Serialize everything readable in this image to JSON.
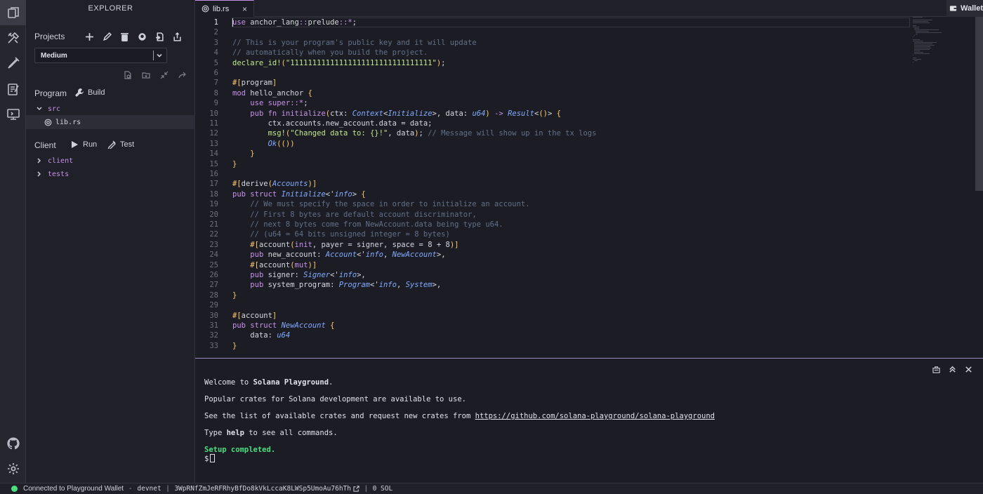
{
  "activity": {
    "items": [
      {
        "name": "explorer-icon",
        "active": true
      },
      {
        "name": "build-deploy-icon"
      },
      {
        "name": "test-icon"
      },
      {
        "name": "tutorials-icon"
      },
      {
        "name": "programs-icon"
      }
    ],
    "bottom": [
      "github-icon",
      "settings-icon"
    ]
  },
  "sidebar": {
    "title": "EXPLORER",
    "projects_label": "Projects",
    "project_select": "Medium",
    "program_label": "Program",
    "build_label": "Build",
    "client_label": "Client",
    "run_label": "Run",
    "test_label": "Test",
    "tree": {
      "src_folder": "src",
      "lib_file": "lib.rs",
      "client_folder": "client",
      "tests_folder": "tests"
    }
  },
  "tabs": [
    {
      "label": "lib.rs",
      "close": "×"
    }
  ],
  "wallet_button": "Wallet",
  "editor": {
    "active_line": 1,
    "line_numbers": [
      "1",
      "2",
      "3",
      "4",
      "5",
      "6",
      "7",
      "8",
      "9",
      "10",
      "11",
      "12",
      "13",
      "14",
      "15",
      "16",
      "17",
      "18",
      "19",
      "20",
      "21",
      "22",
      "23",
      "24",
      "25",
      "26",
      "27",
      "28",
      "29",
      "30",
      "31",
      "32",
      "33"
    ],
    "lines": [
      "use anchor_lang::prelude::*;",
      "",
      "// This is your program's public key and it will update",
      "// automatically when you build the project.",
      "declare_id!(\"11111111111111111111111111111111\");",
      "",
      "#[program]",
      "mod hello_anchor {",
      "    use super::*;",
      "    pub fn initialize(ctx: Context<Initialize>, data: u64) -> Result<()> {",
      "        ctx.accounts.new_account.data = data;",
      "        msg!(\"Changed data to: {}!\", data); // Message will show up in the tx logs",
      "        Ok(())",
      "    }",
      "}",
      "",
      "#[derive(Accounts)]",
      "pub struct Initialize<'info> {",
      "    // We must specify the space in order to initialize an account.",
      "    // First 8 bytes are default account discriminator,",
      "    // next 8 bytes come from NewAccount.data being type u64.",
      "    // (u64 = 64 bits unsigned integer = 8 bytes)",
      "    #[account(init, payer = signer, space = 8 + 8)]",
      "    pub new_account: Account<'info, NewAccount>,",
      "    #[account(mut)]",
      "    pub signer: Signer<'info>,",
      "    pub system_program: Program<'info, System>,",
      "}",
      "",
      "#[account]",
      "pub struct NewAccount {",
      "    data: u64",
      "}"
    ]
  },
  "terminal": {
    "welcome_prefix": "Welcome to ",
    "welcome_bold": "Solana Playground",
    "welcome_suffix": ".",
    "crates_line": "Popular crates for Solana development are available to use.",
    "list_prefix": "See the list of available crates and request new crates from ",
    "list_link": "https://github.com/solana-playground/solana-playground",
    "help_prefix": "Type ",
    "help_bold": "help",
    "help_suffix": " to see all commands.",
    "setup": "Setup completed.",
    "prompt": "$"
  },
  "status": {
    "connection": "Connected to Playground Wallet",
    "dash": "-",
    "network": "devnet",
    "address": "3WpRNfZmJeRFRhyBfDo8kVkLccaK8LWSp5UmoAu76hTh",
    "balance": "0 SOL",
    "colors": {
      "connected": "#4ade80"
    }
  }
}
